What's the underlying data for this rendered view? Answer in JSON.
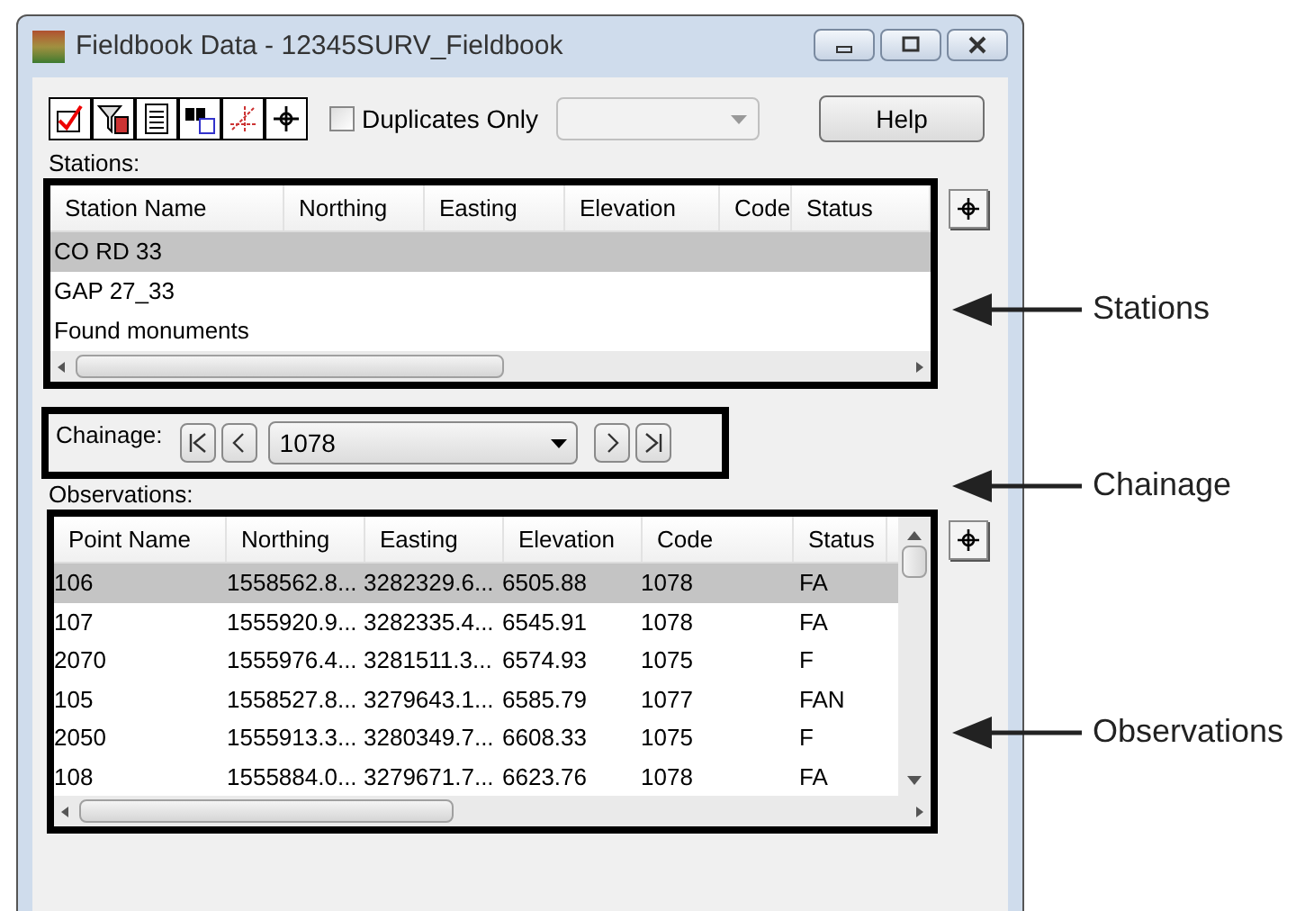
{
  "window": {
    "title": "Fieldbook Data - 12345SURV_Fieldbook"
  },
  "toolbar": {
    "duplicates_only": {
      "label": "Duplicates Only",
      "checked": false
    },
    "help_button": "Help"
  },
  "stations": {
    "label": "Stations:",
    "columns": [
      "Station Name",
      "Northing",
      "Easting",
      "Elevation",
      "Code",
      "Status"
    ],
    "rows": [
      {
        "name": "CO RD 33",
        "selected": true
      },
      {
        "name": "GAP 27_33",
        "selected": false
      },
      {
        "name": "Found monuments",
        "selected": false
      }
    ]
  },
  "chainage": {
    "label": "Chainage:",
    "value": "1078"
  },
  "observations": {
    "label": "Observations:",
    "columns": [
      "Point Name",
      "Northing",
      "Easting",
      "Elevation",
      "Code",
      "Status"
    ],
    "rows": [
      {
        "cells": [
          "106",
          "1558562.8...",
          "3282329.6...",
          "6505.88",
          "1078",
          "FA"
        ],
        "selected": true
      },
      {
        "cells": [
          "107",
          "1555920.9...",
          "3282335.4...",
          "6545.91",
          "1078",
          "FA"
        ],
        "selected": false
      },
      {
        "cells": [
          "2070",
          "1555976.4...",
          "3281511.3...",
          "6574.93",
          "1075",
          "F"
        ],
        "selected": false
      },
      {
        "cells": [
          "105",
          "1558527.8...",
          "3279643.1...",
          "6585.79",
          "1077",
          "FAN"
        ],
        "selected": false
      },
      {
        "cells": [
          "2050",
          "1555913.3...",
          "3280349.7...",
          "6608.33",
          "1075",
          "F"
        ],
        "selected": false
      },
      {
        "cells": [
          "108",
          "1555884.0...",
          "3279671.7...",
          "6623.76",
          "1078",
          "FA"
        ],
        "selected": false
      }
    ]
  },
  "callouts": [
    "Stations",
    "Chainage",
    "Observations"
  ]
}
